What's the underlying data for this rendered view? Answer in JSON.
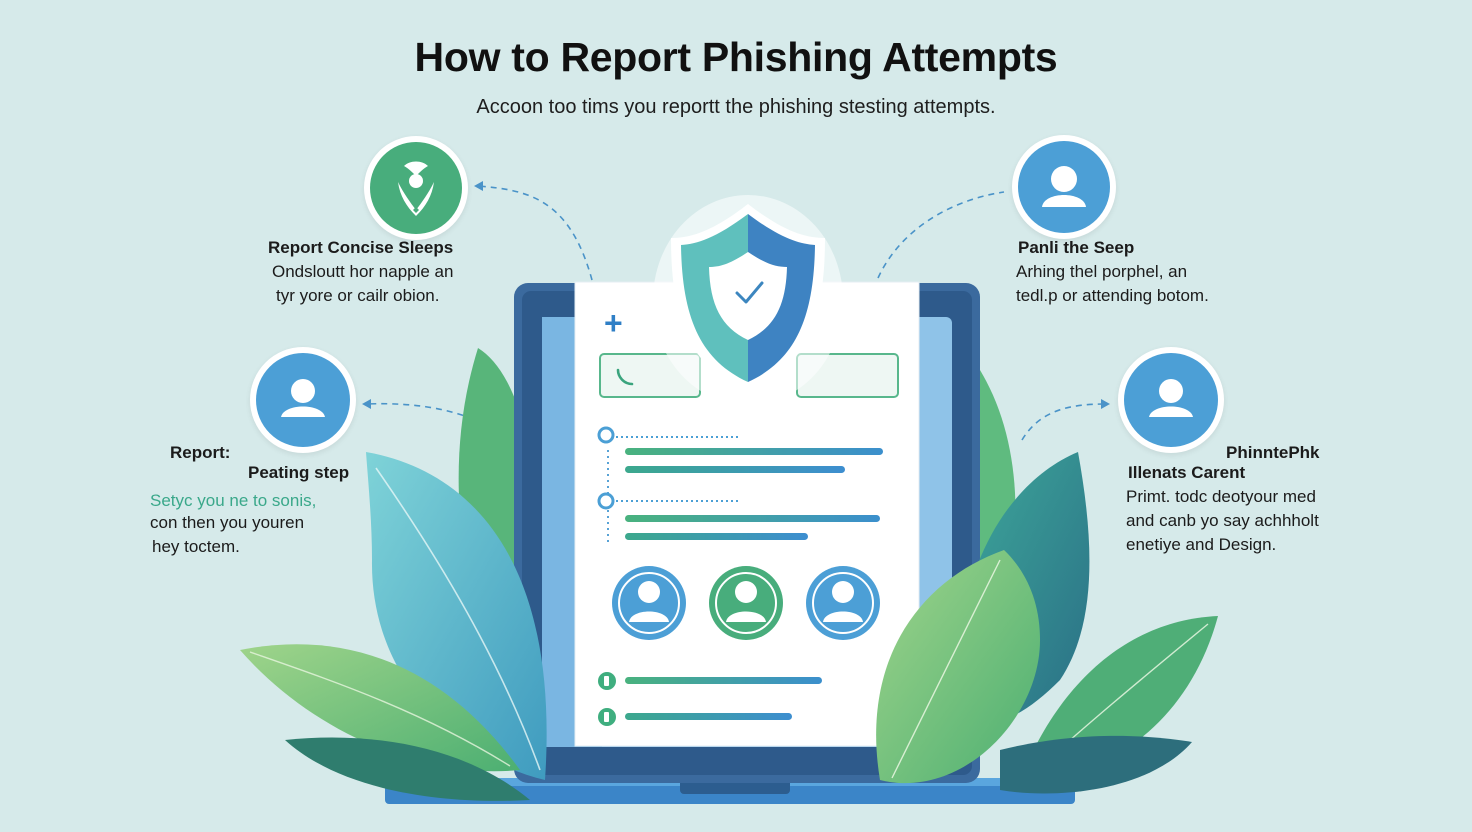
{
  "title": "How to Report Phishing Attempts",
  "subtitle": "Accoon too tims you reportt the phishing stesting attempts.",
  "left_top": {
    "icon": "user-shield-icon",
    "heading": "Report Concise Sleeps",
    "lines": [
      "Ondsloutt hor napple an",
      "tyr yore or cailr obion."
    ]
  },
  "left_mid": {
    "icon": "user-icon",
    "label": "Report:",
    "heading": "Peating step",
    "highlight": "Setyc you ne to sonis,",
    "lines": [
      "con then you youren",
      "hey toctem."
    ]
  },
  "right_top": {
    "icon": "user-icon",
    "heading": "Panli the Seep",
    "lines": [
      "Arhing thel porphel, an",
      "tedl.p or attending botom."
    ]
  },
  "right_mid": {
    "icon": "user-icon",
    "label": "PhinntePhk",
    "heading": "Illenats Carent",
    "lines": [
      "Primt. todc deotyour med",
      "and canb yo say achhholt",
      "enetiye and Design."
    ]
  },
  "device": {
    "plus_symbol": "+",
    "shield_icon": "shield-check-icon",
    "phone_icon": "phone-icon",
    "avatars": [
      "user-icon",
      "user-icon",
      "user-icon"
    ],
    "step_markers": [
      "step-marker-icon",
      "step-marker-icon"
    ],
    "list_markers": [
      "bullet-icon",
      "bullet-icon"
    ]
  },
  "colors": {
    "background": "#d6eaea",
    "green": "#4caf86",
    "blue": "#4a9fd4",
    "navy": "#2d5a8c",
    "leaf_teal": "#5fc3c9"
  }
}
